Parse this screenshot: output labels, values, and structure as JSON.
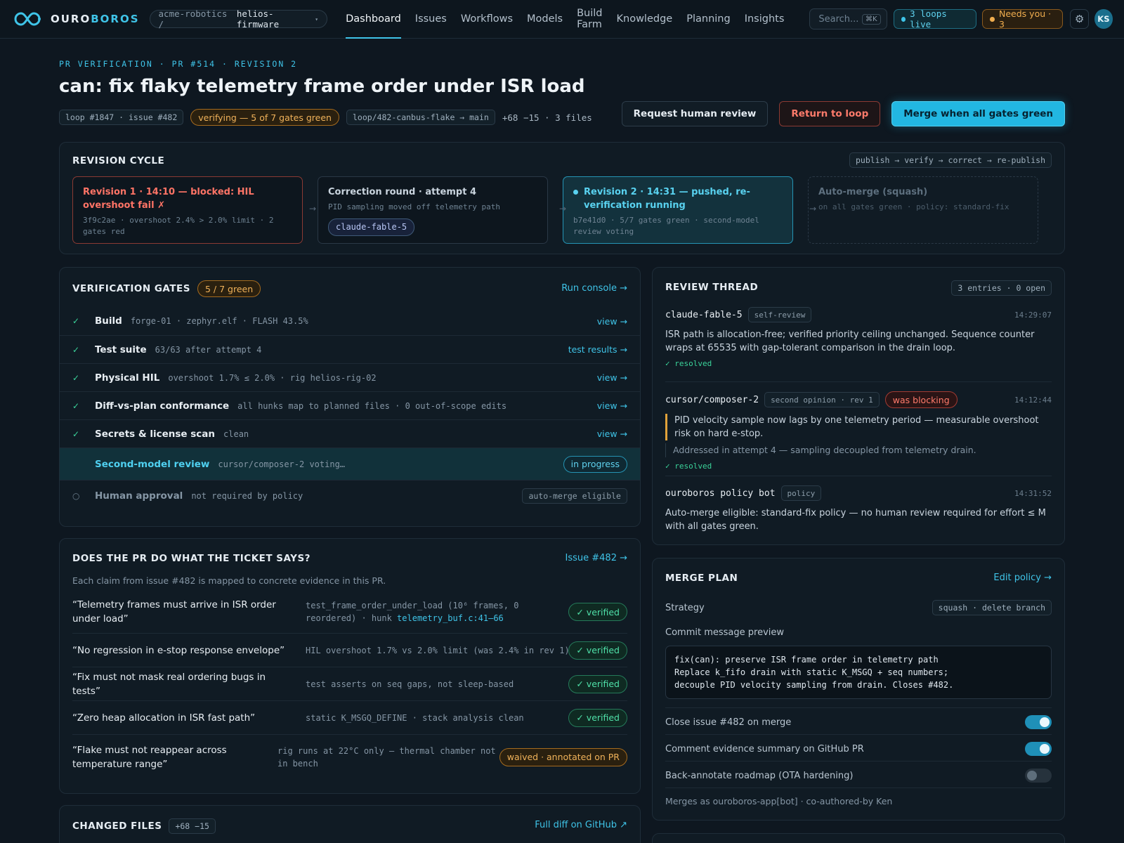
{
  "app": {
    "brand_a": "OURO",
    "brand_b": "BOROS",
    "org": "acme-robotics /",
    "repo": "helios-firmware"
  },
  "nav": [
    "Dashboard",
    "Issues",
    "Workflows",
    "Models",
    "Build Farm",
    "Knowledge",
    "Planning",
    "Insights"
  ],
  "search": {
    "placeholder": "Search...",
    "shortcut": "⌘K"
  },
  "status": {
    "loops": "3 loops live",
    "needs": "Needs you · 3",
    "avatar": "KS"
  },
  "pr": {
    "eyebrow": "PR VERIFICATION · PR #514 · REVISION 2",
    "title": "can: fix flaky telemetry frame order under ISR load",
    "loop": "loop #1847 · issue #482",
    "verifying": "verifying — 5 of 7 gates green",
    "branch": "loop/482-canbus-flake → main",
    "diffstat": "+68 −15 · 3 files",
    "actions": {
      "review": "Request human review",
      "return": "Return to loop",
      "merge": "Merge when all gates green"
    }
  },
  "revision": {
    "title": "REVISION CYCLE",
    "flow": "publish → verify → correct → re-publish",
    "steps": [
      {
        "title": "Revision 1 · 14:10 — blocked: HIL overshoot fail ✗",
        "sub": "3f9c2ae · overshoot 2.4% > 2.0% limit · 2 gates red"
      },
      {
        "title": "Correction round · attempt 4",
        "sub": "PID sampling moved off telemetry path",
        "chip": "claude-fable-5"
      },
      {
        "title": "Revision 2 · 14:31 — pushed, re-verification running",
        "sub": "b7e41d0 · 5/7 gates green · second-model review voting"
      },
      {
        "title": "Auto-merge (squash)",
        "sub": "on all gates green · policy: standard-fix"
      }
    ],
    "arrow": "→"
  },
  "gates": {
    "title": "VERIFICATION GATES",
    "count": "5 / 7 green",
    "console": "Run console →",
    "rows": [
      {
        "check": "✓",
        "name": "Build",
        "detail": "forge-01 · zephyr.elf · FLASH 43.5%",
        "link": "view →"
      },
      {
        "check": "✓",
        "name": "Test suite",
        "detail": "63/63 after attempt 4",
        "link": "test results →"
      },
      {
        "check": "✓",
        "name": "Physical HIL",
        "detail": "overshoot 1.7% ≤ 2.0% · rig helios-rig-02",
        "link": "view →"
      },
      {
        "check": "✓",
        "name": "Diff-vs-plan conformance",
        "detail": "all hunks map to planned files · 0 out-of-scope edits",
        "link": "view →"
      },
      {
        "check": "✓",
        "name": "Secrets & license scan",
        "detail": "clean",
        "link": "view →"
      },
      {
        "check": "",
        "name": "Second-model review",
        "detail": "cursor/composer-2 voting…",
        "link": "in progress"
      },
      {
        "check": "○",
        "name": "Human approval",
        "detail": "not required by policy",
        "link": "auto-merge eligible"
      }
    ]
  },
  "ticket": {
    "title": "DOES THE PR DO WHAT THE TICKET SAYS?",
    "issue_link": "Issue #482 →",
    "subtitle": "Each claim from issue #482 is mapped to concrete evidence in this PR.",
    "claims": [
      {
        "claim": "“Telemetry frames must arrive in ISR order under load”",
        "evidence": "test_frame_order_under_load (10⁶ frames, 0 reordered) · hunk ",
        "evidence_link": "telemetry_buf.c:41–66",
        "status": "✓ verified"
      },
      {
        "claim": "“No regression in e-stop response envelope”",
        "evidence": "HIL overshoot 1.7% vs 2.0% limit (was 2.4% in rev 1)",
        "evidence_link": "",
        "status": "✓ verified"
      },
      {
        "claim": "“Fix must not mask real ordering bugs in tests”",
        "evidence": "test asserts on seq gaps, not sleep-based",
        "evidence_link": "",
        "status": "✓ verified"
      },
      {
        "claim": "“Zero heap allocation in ISR fast path”",
        "evidence": "static K_MSGQ_DEFINE · stack analysis clean",
        "evidence_link": "",
        "status": "✓ verified"
      },
      {
        "claim": "“Flake must not reappear across temperature range”",
        "evidence": "rig runs at 22°C only — thermal chamber not in bench",
        "evidence_link": "",
        "status": "waived · annotated on PR"
      }
    ]
  },
  "changed": {
    "title": "CHANGED FILES",
    "stat": "+68 −15",
    "link": "Full diff on GitHub ↗"
  },
  "thread": {
    "title": "REVIEW THREAD",
    "count": "3 entries · 0 open",
    "entries": [
      {
        "who": "claude-fable-5",
        "tag": "self-review",
        "time": "14:29:07",
        "body": "ISR path is allocation-free; verified priority ceiling unchanged. Sequence counter wraps at 65535 with gap-tolerant comparison in the drain loop.",
        "resolved": "✓ resolved"
      },
      {
        "who": "cursor/composer-2",
        "tag": "second opinion · rev 1",
        "flag": "was blocking",
        "time": "14:12:44",
        "body": "PID velocity sample now lags by one telemetry period — measurable overshoot risk on hard e-stop.",
        "reply": "Addressed in attempt 4 — sampling decoupled from telemetry drain.",
        "resolved": "✓ resolved"
      },
      {
        "who": "ouroboros policy bot",
        "tag": "policy",
        "time": "14:31:52",
        "body": "Auto-merge eligible: standard-fix policy — no human review required for effort ≤ M with all gates green."
      }
    ]
  },
  "merge": {
    "title": "MERGE PLAN",
    "edit": "Edit policy →",
    "strategy_label": "Strategy",
    "strategy": "squash · delete branch",
    "commit_label": "Commit message preview",
    "commit": "fix(can): preserve ISR frame order in telemetry path\nReplace k_fifo drain with static K_MSGQ + seq numbers;\ndecouple PID velocity sampling from drain. Closes #482.",
    "toggles": [
      {
        "label": "Close issue #482 on merge",
        "on": true
      },
      {
        "label": "Comment evidence summary on GitHub PR",
        "on": true
      },
      {
        "label": "Back-annotate roadmap (OTA hardening)",
        "on": false
      }
    ],
    "footer": "Merges as ouroboros-app[bot] · co-authored-by Ken"
  },
  "colors": {
    "accent": "#3fc4e8",
    "ok": "#3ad39a",
    "warn": "#f0b25a",
    "danger": "#ff7b6b"
  }
}
